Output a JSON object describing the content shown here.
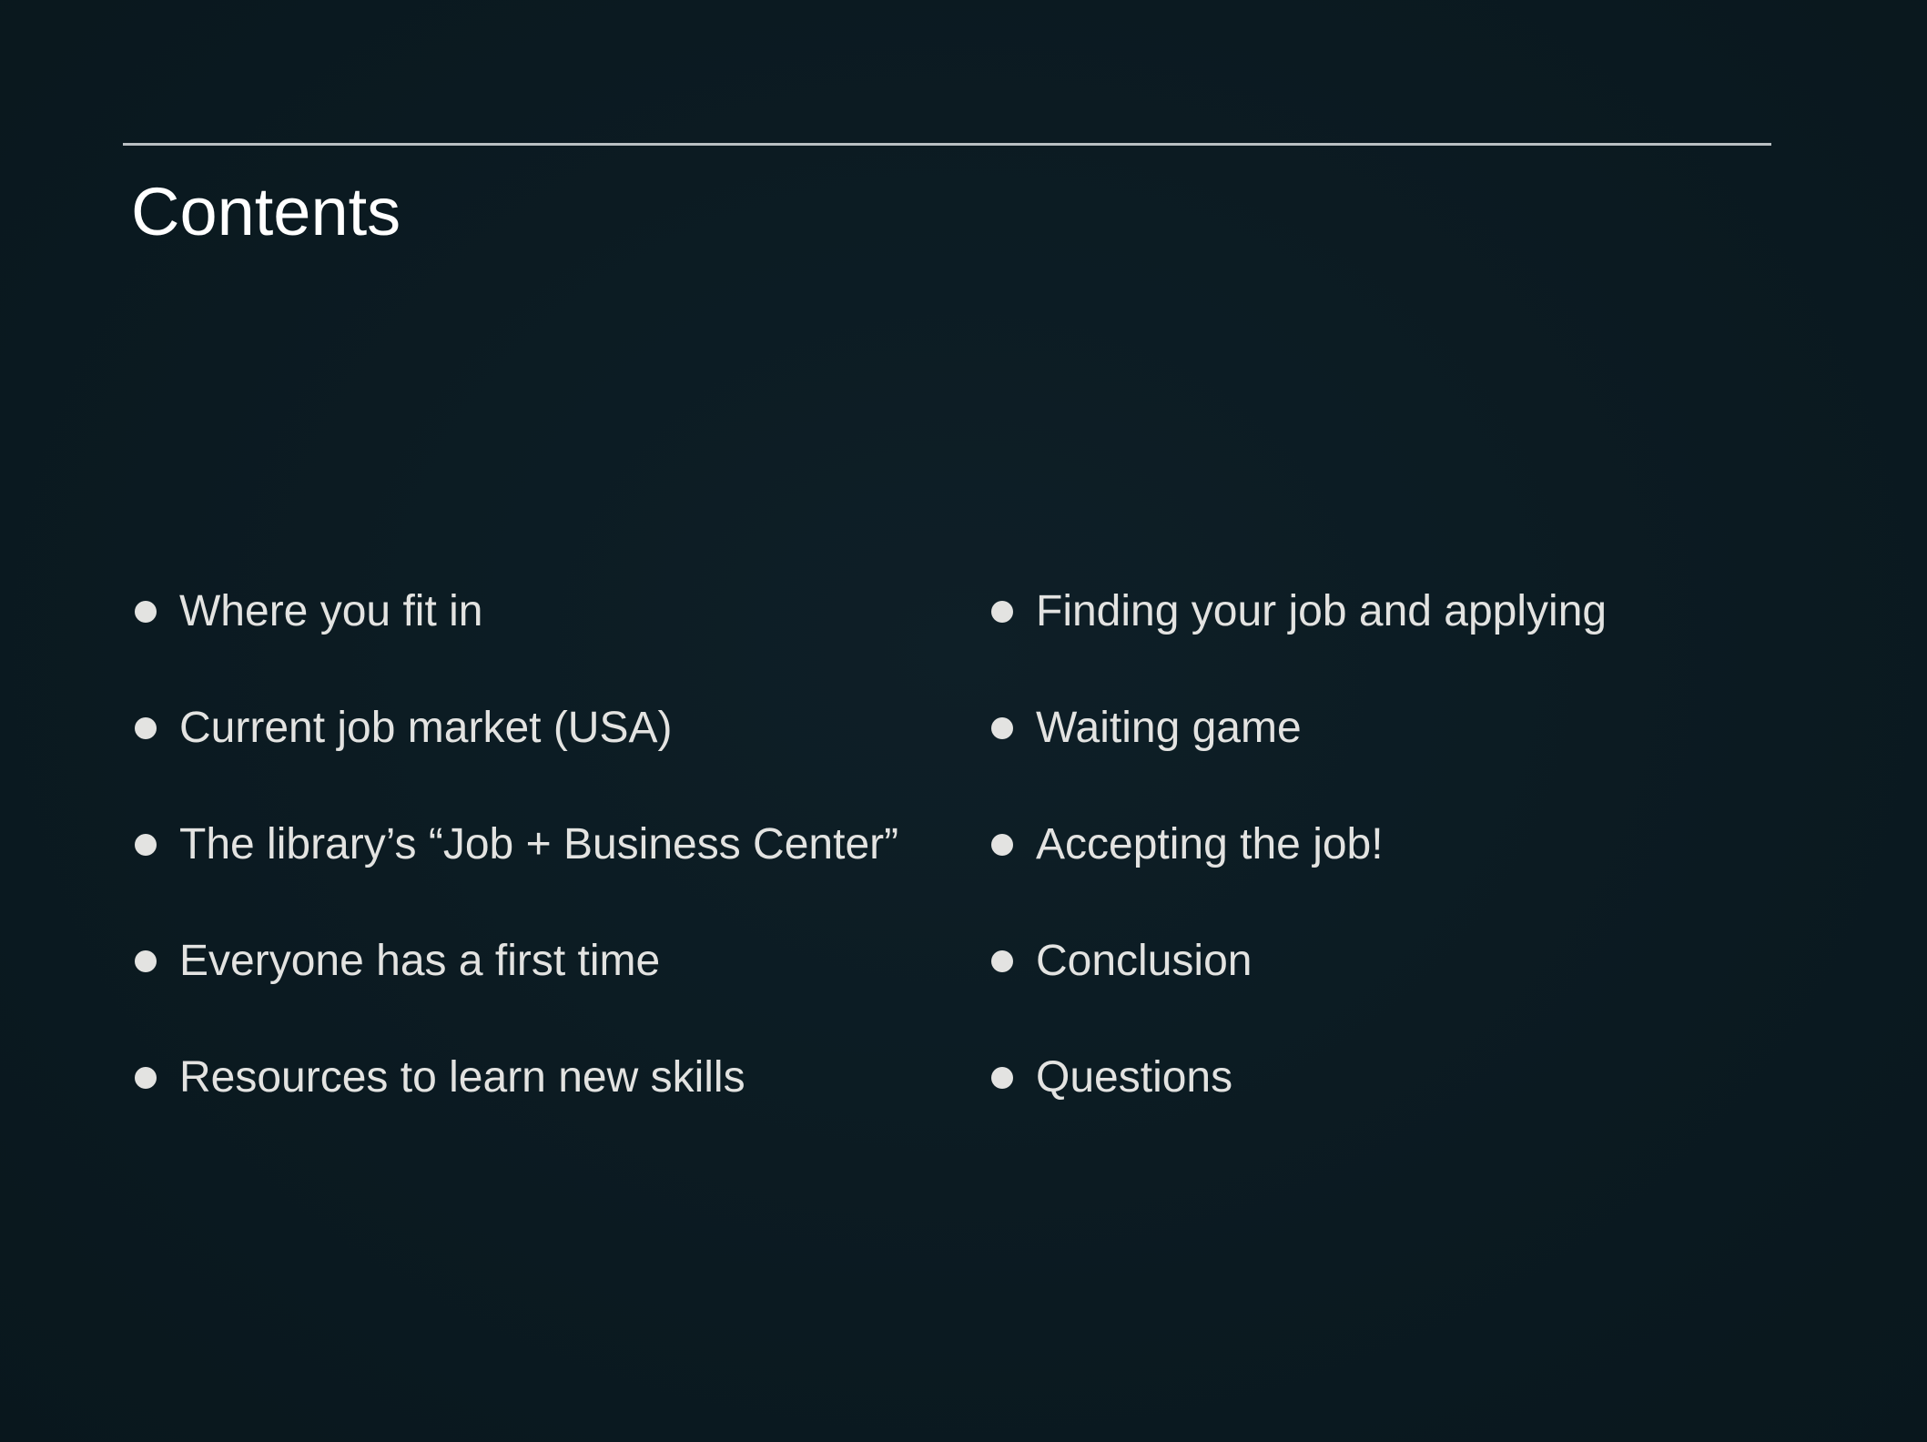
{
  "slide": {
    "title": "Contents",
    "colors": {
      "background": "#0b1b22",
      "text": "#e3e3e1",
      "title": "#ffffff",
      "rule": "#b9bfc2"
    },
    "left_items": [
      "Where you fit in",
      "Current job market (USA)",
      "The library’s “Job + Business Center”",
      "Everyone has a first time",
      "Resources to learn new skills"
    ],
    "right_items": [
      "Finding your job and applying",
      "Waiting game",
      "Accepting the job!",
      "Conclusion",
      "Questions"
    ]
  }
}
